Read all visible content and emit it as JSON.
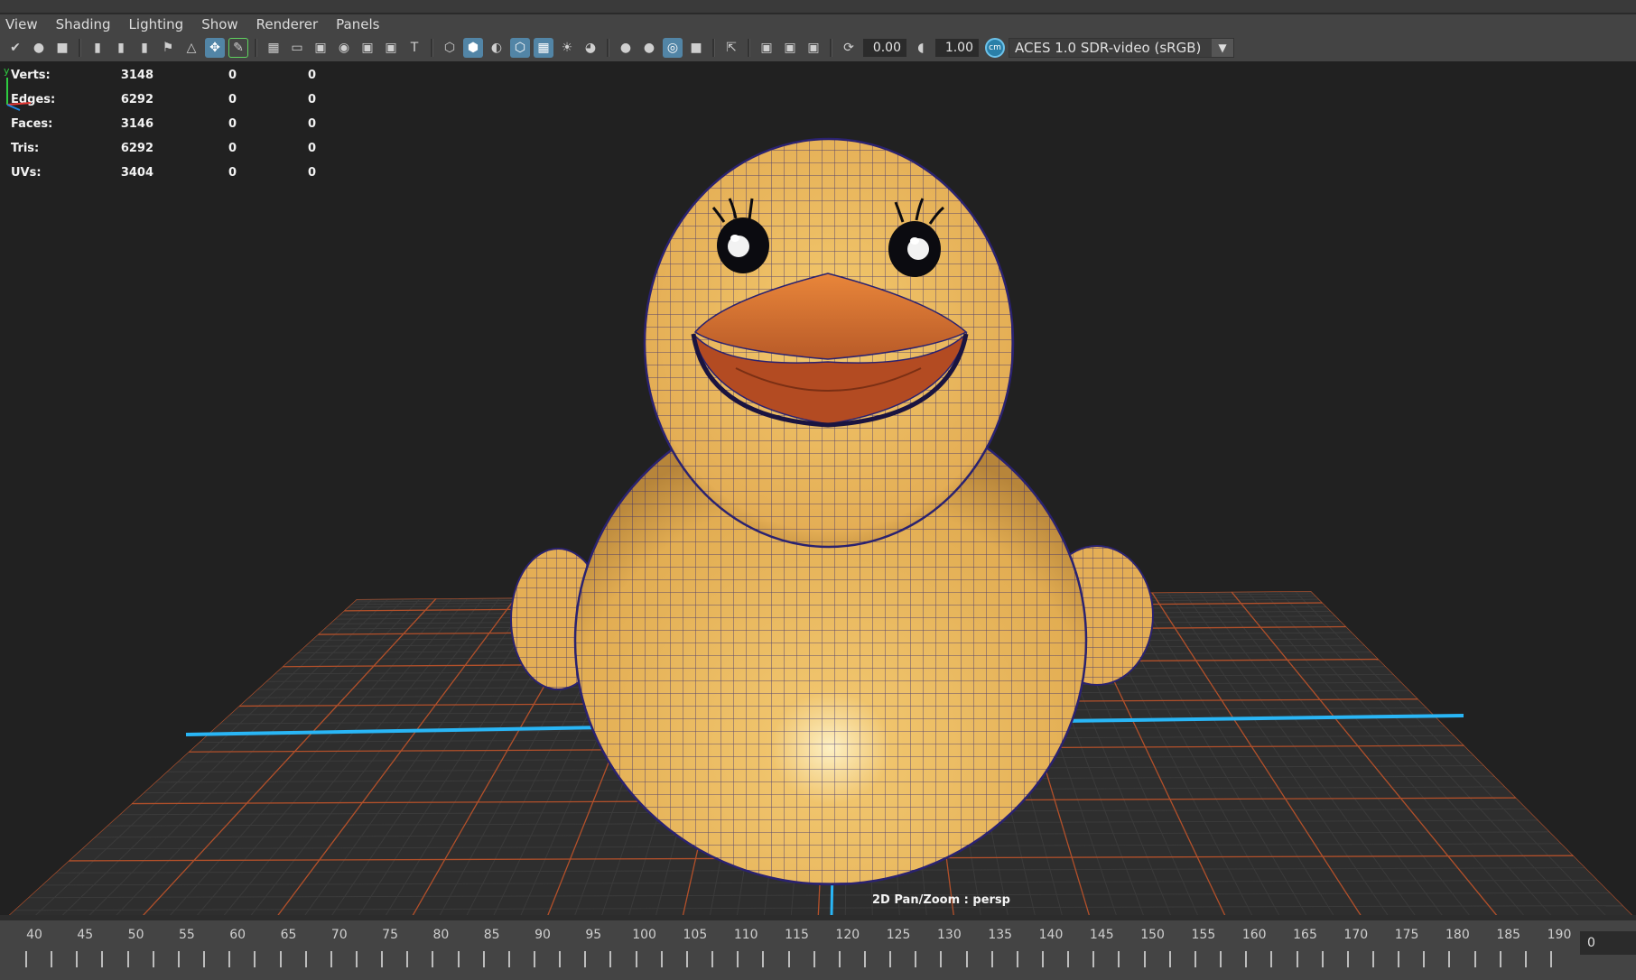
{
  "menu": [
    "View",
    "Shading",
    "Lighting",
    "Show",
    "Renderer",
    "Panels"
  ],
  "toolbar": {
    "exposure": "0.00",
    "gamma": "1.00",
    "color_management_icon": "cm-icon",
    "view_transform": "ACES 1.0 SDR-video (sRGB)"
  },
  "stats": [
    {
      "label": "Verts:",
      "value": "3148",
      "a": "0",
      "b": "0"
    },
    {
      "label": "Edges:",
      "value": "6292",
      "a": "0",
      "b": "0"
    },
    {
      "label": "Faces:",
      "value": "3146",
      "a": "0",
      "b": "0"
    },
    {
      "label": "Tris:",
      "value": "6292",
      "a": "0",
      "b": "0"
    },
    {
      "label": "UVs:",
      "value": "3404",
      "a": "0",
      "b": "0"
    }
  ],
  "viewport": {
    "hud_text": "2D Pan/Zoom : persp",
    "axis_y": "y"
  },
  "timeline": {
    "ticks": [
      "40",
      "45",
      "50",
      "55",
      "60",
      "65",
      "70",
      "75",
      "80",
      "85",
      "90",
      "95",
      "100",
      "105",
      "110",
      "115",
      "120",
      "125",
      "130",
      "135",
      "140",
      "145",
      "150",
      "155",
      "160",
      "165",
      "170",
      "175",
      "180",
      "185",
      "190"
    ],
    "current_frame": "0"
  },
  "colors": {
    "duck_yellow": "#e9b85a",
    "beak_orange": "#d9742f",
    "wire": "#2a2270",
    "grid_orange": "#c0552a",
    "axis_blue": "#29b6f6"
  }
}
